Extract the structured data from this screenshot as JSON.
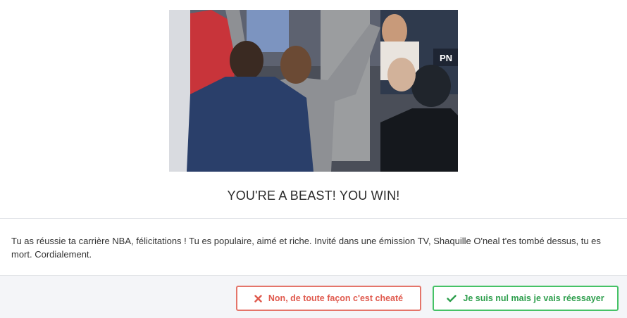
{
  "modal": {
    "title": "YOU'RE A BEAST! YOU WIN!",
    "message": "Tu as réussie ta carrière NBA, félicitations ! Tu es populaire, aimé et riche. Invité dans une émission TV, Shaquille O'neal t'es tombé dessus, tu es mort. Cordialement.",
    "gif": {
      "icon": "celebration-gif-image",
      "banner_text": "PN"
    }
  },
  "buttons": {
    "cancel": {
      "label": "Non, de toute façon c'est cheaté",
      "icon": "close-icon",
      "color": "#e05a4e"
    },
    "retry": {
      "label": "Je suis nul mais je vais réessayer",
      "icon": "check-icon",
      "color": "#2d9e4c"
    }
  }
}
